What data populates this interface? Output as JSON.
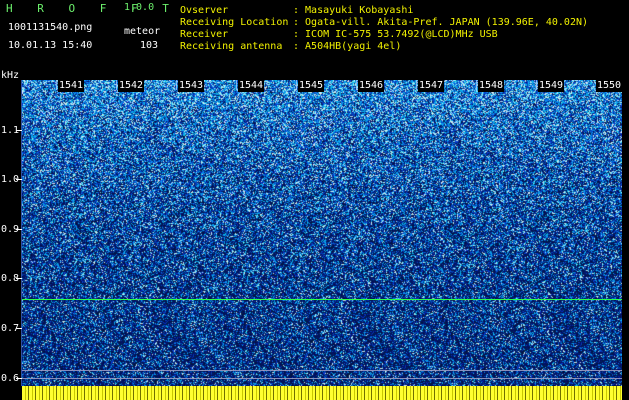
{
  "app": {
    "brand": "H R O F F T",
    "version": "1.0.0"
  },
  "file": {
    "name": "1001131540.png",
    "datetime": "10.01.13 15:40"
  },
  "counter": {
    "label": "meteor",
    "value": "103"
  },
  "info": {
    "observer_label": "Ovserver",
    "observer_value": ": Masayuki Kobayashi",
    "location_label": "Receiving Location",
    "location_value": ": Ogata-vill. Akita-Pref. JAPAN (139.96E, 40.02N)",
    "receiver_label": "Receiver",
    "receiver_value": ": ICOM IC-575 53.7492(@LCD)MHz USB",
    "antenna_label": "Receiving antenna",
    "antenna_value": ": A504HB(yagi 4el)"
  },
  "axis": {
    "unit": "kHz",
    "y_ticks": [
      "1.1",
      "1.0",
      "0.9",
      "0.8",
      "0.7",
      "0.6"
    ],
    "x_ticks": [
      "1541",
      "1542",
      "1543",
      "1544",
      "1545",
      "1546",
      "1547",
      "1548",
      "1549",
      "1550"
    ]
  },
  "colors": {
    "brand": "#6cf06c",
    "accent": "#f2f200",
    "marker": "#2aff4a",
    "background": "#000000"
  }
}
